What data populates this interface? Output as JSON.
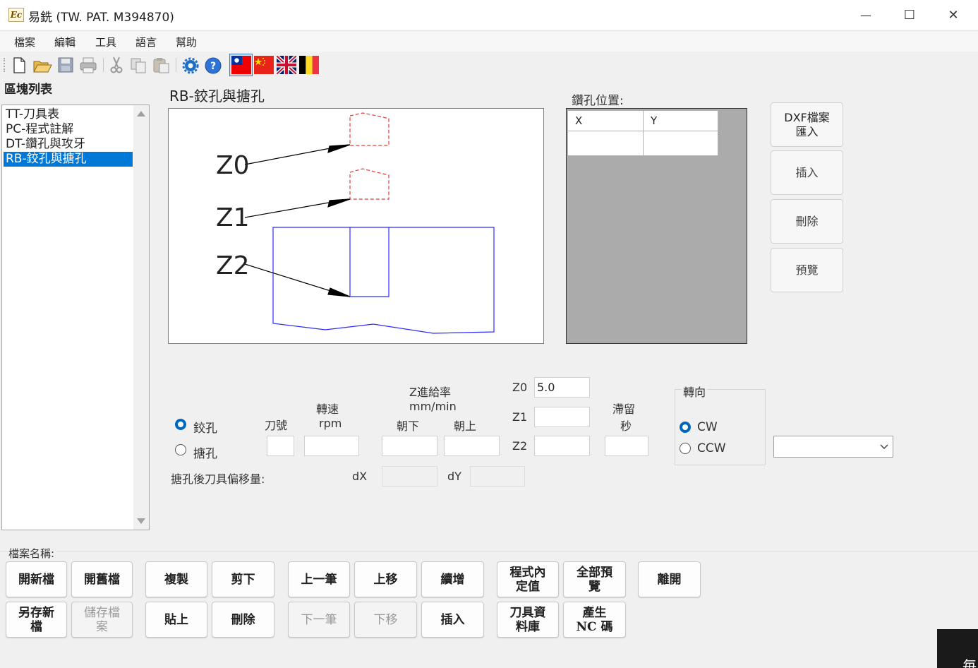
{
  "window": {
    "title": "易銑 (TW. PAT. M394870)",
    "app_icon": "Ec",
    "controls": {
      "minimize": "—",
      "maximize": "☐",
      "close": "✕"
    }
  },
  "menu": [
    "檔案",
    "編輯",
    "工具",
    "語言",
    "幫助"
  ],
  "toolbar": {
    "icons": [
      "new-file-icon",
      "open-folder-icon",
      "save-icon",
      "print-icon",
      "cut-icon",
      "copy-icon",
      "paste-icon",
      "settings-icon",
      "help-icon",
      "flag-taiwan-icon",
      "flag-china-icon",
      "flag-uk-icon",
      "flag-belgium-icon"
    ]
  },
  "block_list": {
    "label": "區塊列表",
    "items": [
      "TT-刀具表",
      "PC-程式註解",
      "DT-鑽孔與攻牙",
      "RB-鉸孔與搪孔"
    ],
    "selected_index": 3
  },
  "diagram": {
    "title": "RB-鉸孔與搪孔",
    "labels": [
      "Z0",
      "Z1",
      "Z2"
    ]
  },
  "drill_positions": {
    "label": "鑽孔位置:",
    "columns": [
      "X",
      "Y"
    ]
  },
  "side_buttons": {
    "dxf_import": "DXF檔案\n匯入",
    "insert": "插入",
    "delete": "刪除",
    "preview": "預覽"
  },
  "params": {
    "mode_ream": "鉸孔",
    "mode_bore": "搪孔",
    "tool_no": "刀號",
    "speed": "轉速",
    "speed_unit": "rpm",
    "z_feed": "Z進給率",
    "z_feed_unit": "mm/min",
    "down": "朝下",
    "up": "朝上",
    "z0_label": "Z0",
    "z0_value": "5.0",
    "z1_label": "Z1",
    "z1_value": "",
    "z2_label": "Z2",
    "z2_value": "",
    "dwell": "滯留",
    "dwell_unit": "秒",
    "direction": "轉向",
    "cw": "CW",
    "ccw": "CCW",
    "offset_label": "搪孔後刀具偏移量:",
    "dx": "dX",
    "dy": "dY",
    "combo_value": ""
  },
  "file": {
    "label": "檔案名稱:"
  },
  "buttons": {
    "new_file": "開新檔",
    "open_file": "開舊檔",
    "copy": "複製",
    "cut": "剪下",
    "prev": "上一筆",
    "move_up": "上移",
    "continue_add": "續增",
    "program_default": "程式內\n定值",
    "preview_all": "全部預\n覽",
    "exit": "離開",
    "save_new": "另存新\n檔",
    "save": "儲存檔\n案",
    "paste": "貼上",
    "delete": "刪除",
    "next": "下一筆",
    "move_down": "下移",
    "insert": "插入",
    "tool_db": "刀具資\n料庫",
    "gen_nc": "產生\nNC 碼"
  },
  "corner_text": "毎"
}
